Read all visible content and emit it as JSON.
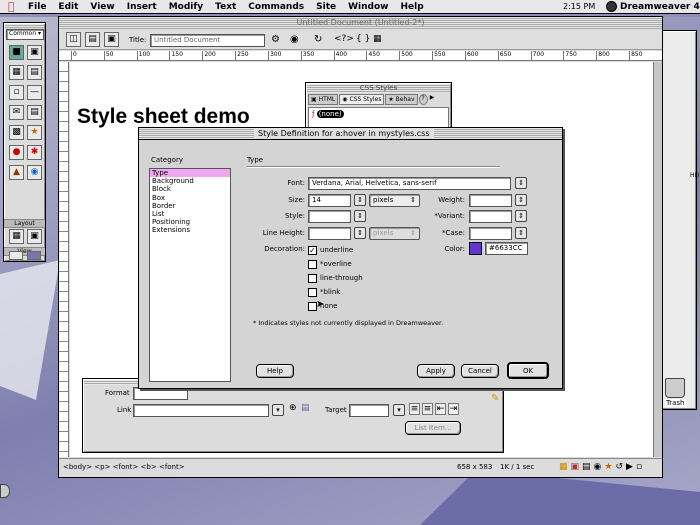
{
  "menubar": {
    "items": [
      "File",
      "Edit",
      "View",
      "Insert",
      "Modify",
      "Text",
      "Commands",
      "Site",
      "Window",
      "Help"
    ],
    "clock": "2:15 PM",
    "app": "Dreamweaver 4"
  },
  "objects_palette": {
    "dropdown": "Common",
    "layout_label": "Layout",
    "view_label": "View"
  },
  "document": {
    "title": "Untitled Document (Untitled-2*)",
    "title_label": "Title:",
    "title_value": "Untitled Document",
    "ruler_numbers": [
      "0",
      "50",
      "100",
      "150",
      "200",
      "250",
      "300",
      "350",
      "400",
      "450",
      "500",
      "550",
      "600",
      "650",
      "700",
      "750",
      "800",
      "850"
    ],
    "heading": "Style sheet demo",
    "status_tags": "<body> <p> <font> <b> <font>",
    "status_size": "658 x 583",
    "status_speed": "1K / 1 sec"
  },
  "css_panel": {
    "title": "CSS Styles",
    "tabs": [
      "HTML",
      "CSS Styles",
      "Behav"
    ],
    "item": "(none)"
  },
  "properties": {
    "format_label": "Format",
    "link_label": "Link",
    "target_label": "Target",
    "list_item_button": "List Item..."
  },
  "dialog": {
    "title": "Style Definition for a:hover in mystyles.css",
    "category_label": "Category",
    "type_label": "Type",
    "categories": [
      "Type",
      "Background",
      "Block",
      "Box",
      "Border",
      "List",
      "Positioning",
      "Extensions"
    ],
    "font_label": "Font:",
    "font_value": "Verdana, Arial, Helvetica, sans-serif",
    "size_label": "Size:",
    "size_value": "14",
    "size_unit": "pixels",
    "weight_label": "Weight:",
    "style_label": "Style:",
    "variant_label": "*Variant:",
    "line_height_label": "Line Height:",
    "line_height_unit": "pixels",
    "case_label": "*Case:",
    "decoration_label": "Decoration:",
    "decorations": [
      {
        "label": "underline",
        "checked": true
      },
      {
        "label": "*overline",
        "checked": false
      },
      {
        "label": "line-through",
        "checked": false
      },
      {
        "label": "*blink",
        "checked": false
      },
      {
        "label": "none",
        "checked": false
      }
    ],
    "color_label": "Color:",
    "color_value": "#6633CC",
    "color_swatch": "#6633CC",
    "footnote": "* Indicates styles not currently displayed in Dreamweaver.",
    "help_button": "Help",
    "apply_button": "Apply",
    "cancel_button": "Cancel",
    "ok_button": "OK"
  },
  "desktop": {
    "trash_label": "Trash",
    "hd_label": "HD"
  }
}
